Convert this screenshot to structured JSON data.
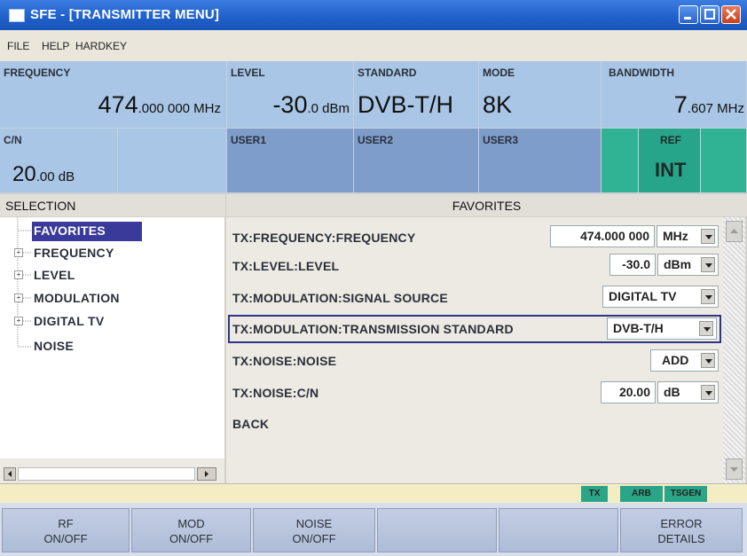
{
  "window": {
    "title": "SFE - [TRANSMITTER MENU]"
  },
  "menu": {
    "items": [
      "FILE",
      "HELP",
      "HARDKEY"
    ]
  },
  "header": {
    "frequency": {
      "label": "FREQUENCY",
      "value_main": "474",
      "value_small": ".000 000 MHz"
    },
    "level": {
      "label": "LEVEL",
      "value_main": "-30",
      "value_small": ".0 dBm"
    },
    "standard": {
      "label": "STANDARD",
      "value": "DVB-T/H"
    },
    "mode": {
      "label": "MODE",
      "value": "8K"
    },
    "bandwidth": {
      "label": "BANDWIDTH",
      "value_main": "7",
      "value_small": ".607 MHz"
    },
    "cn": {
      "label": "C/N",
      "value_main": "20",
      "value_small": ".00 dB"
    },
    "user1": {
      "label": "USER1"
    },
    "user2": {
      "label": "USER2"
    },
    "user3": {
      "label": "USER3"
    },
    "ref": {
      "label": "REF",
      "value": "INT"
    }
  },
  "selection": {
    "title": "SELECTION",
    "items": [
      "FAVORITES",
      "FREQUENCY",
      "LEVEL",
      "MODULATION",
      "DIGITAL TV",
      "NOISE"
    ],
    "selected": "FAVORITES"
  },
  "favorites": {
    "title": "FAVORITES",
    "rows": [
      {
        "label": "TX:FREQUENCY:FREQUENCY",
        "value": "474.000 000",
        "unit": "MHz"
      },
      {
        "label": "TX:LEVEL:LEVEL",
        "value": "-30.0",
        "unit": "dBm"
      },
      {
        "label": "TX:MODULATION:SIGNAL SOURCE",
        "option": "DIGITAL TV"
      },
      {
        "label": "TX:MODULATION:TRANSMISSION STANDARD",
        "option": "DVB-T/H"
      },
      {
        "label": "TX:NOISE:NOISE",
        "option": "ADD"
      },
      {
        "label": "TX:NOISE:C/N",
        "value": "20.00",
        "unit": "dB"
      },
      {
        "label": "BACK"
      }
    ]
  },
  "status": {
    "indicators": [
      "TX",
      "ARB",
      "TSGEN"
    ]
  },
  "softkeys": [
    {
      "line1": "RF",
      "line2": "ON/OFF"
    },
    {
      "line1": "MOD",
      "line2": "ON/OFF"
    },
    {
      "line1": "NOISE",
      "line2": "ON/OFF"
    },
    {
      "line1": "",
      "line2": ""
    },
    {
      "line1": "",
      "line2": ""
    },
    {
      "line1": "ERROR",
      "line2": "DETAILS"
    }
  ],
  "colors": {
    "title_bar": "#1f5fc9",
    "param_light": "#a9c6e6",
    "param_dark": "#7e9dcb",
    "ref_green": "#27a58a",
    "selected": "#3a3a9a"
  }
}
